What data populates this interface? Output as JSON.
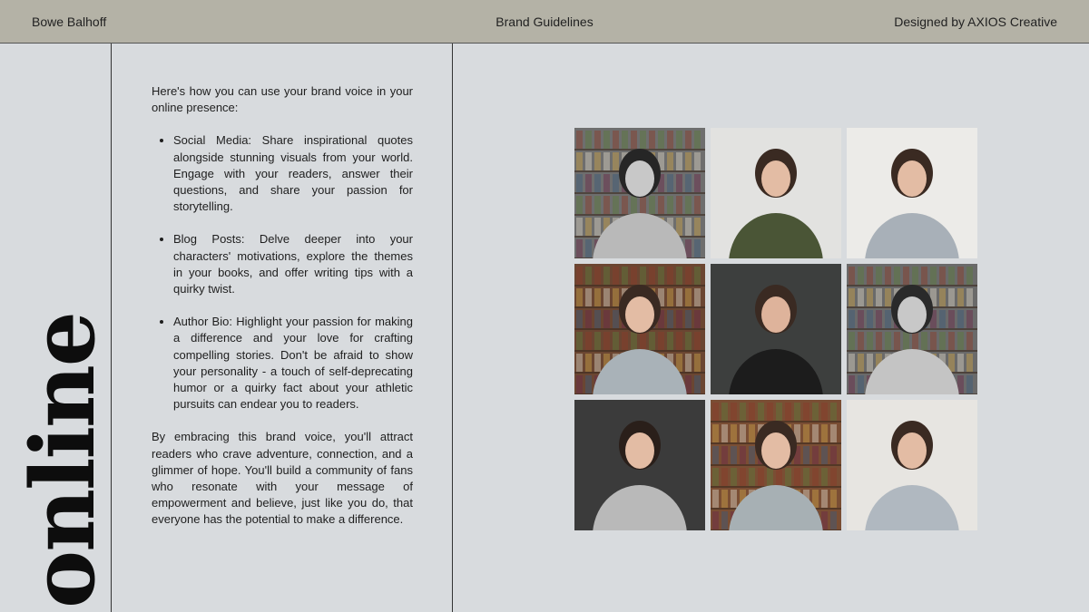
{
  "header": {
    "left": "Bowe Balhoff",
    "center": "Brand Guidelines",
    "right": "Designed by AXIOS Creative"
  },
  "side_title": "online",
  "content": {
    "intro": "Here's how you can use your brand voice in your online presence:",
    "bullets": [
      "Social Media: Share inspirational quotes alongside stunning visuals from your world. Engage with your readers, answer their questions, and share your passion for storytelling.",
      "Blog Posts: Delve deeper into your characters' motivations, explore the themes in your books, and offer writing tips with a quirky twist.",
      "Author Bio: Highlight your passion for making a difference and your love for crafting compelling stories. Don't be afraid to show your personality - a touch of self-deprecating humor or a quirky fact about your athletic pursuits can endear you to readers."
    ],
    "closing": "By embracing this brand voice, you'll attract readers who crave adventure, connection, and a glimmer of hope. You'll build a community of fans who resonate with your message of empowerment and believe, just like you do, that everyone has the potential to make a difference."
  },
  "photos": [
    {
      "subject": "portrait-bookshelf-bw",
      "bg": "#6e6e6e",
      "shirt": "#b9b9b9",
      "hair": "#262626",
      "skin": "#c8c8c8"
    },
    {
      "subject": "holding-book-stack",
      "bg": "#e2e2e0",
      "shirt": "#4a5536",
      "hair": "#3a2a22",
      "skin": "#e3bca4"
    },
    {
      "subject": "reading-red-book",
      "bg": "#ecebe8",
      "shirt": "#a8b0b8",
      "hair": "#3a2a22",
      "skin": "#e3bca4"
    },
    {
      "subject": "sitting-by-bookshelf",
      "bg": "#6b4632",
      "shirt": "#a9b2b8",
      "hair": "#3a2a22",
      "skin": "#e3bca4"
    },
    {
      "subject": "close-up-portrait",
      "bg": "#3d3f3e",
      "shirt": "#1c1c1c",
      "hair": "#3a2a22",
      "skin": "#deb39b"
    },
    {
      "subject": "lying-on-floor-bw",
      "bg": "#6a6a6a",
      "shirt": "#c4c4c4",
      "hair": "#2a2a2a",
      "skin": "#c8c8c8"
    },
    {
      "subject": "seated-dark-backdrop",
      "bg": "#3b3b3b",
      "shirt": "#b9b9b9",
      "hair": "#2a1f1a",
      "skin": "#e3bca4"
    },
    {
      "subject": "holding-books-library",
      "bg": "#7a4e34",
      "shirt": "#a7b0b4",
      "hair": "#3a2a22",
      "skin": "#e3bca4"
    },
    {
      "subject": "reading-with-blanket",
      "bg": "#e7e5e1",
      "shirt": "#b0b8c0",
      "hair": "#3a2a22",
      "skin": "#e3bca4"
    }
  ]
}
